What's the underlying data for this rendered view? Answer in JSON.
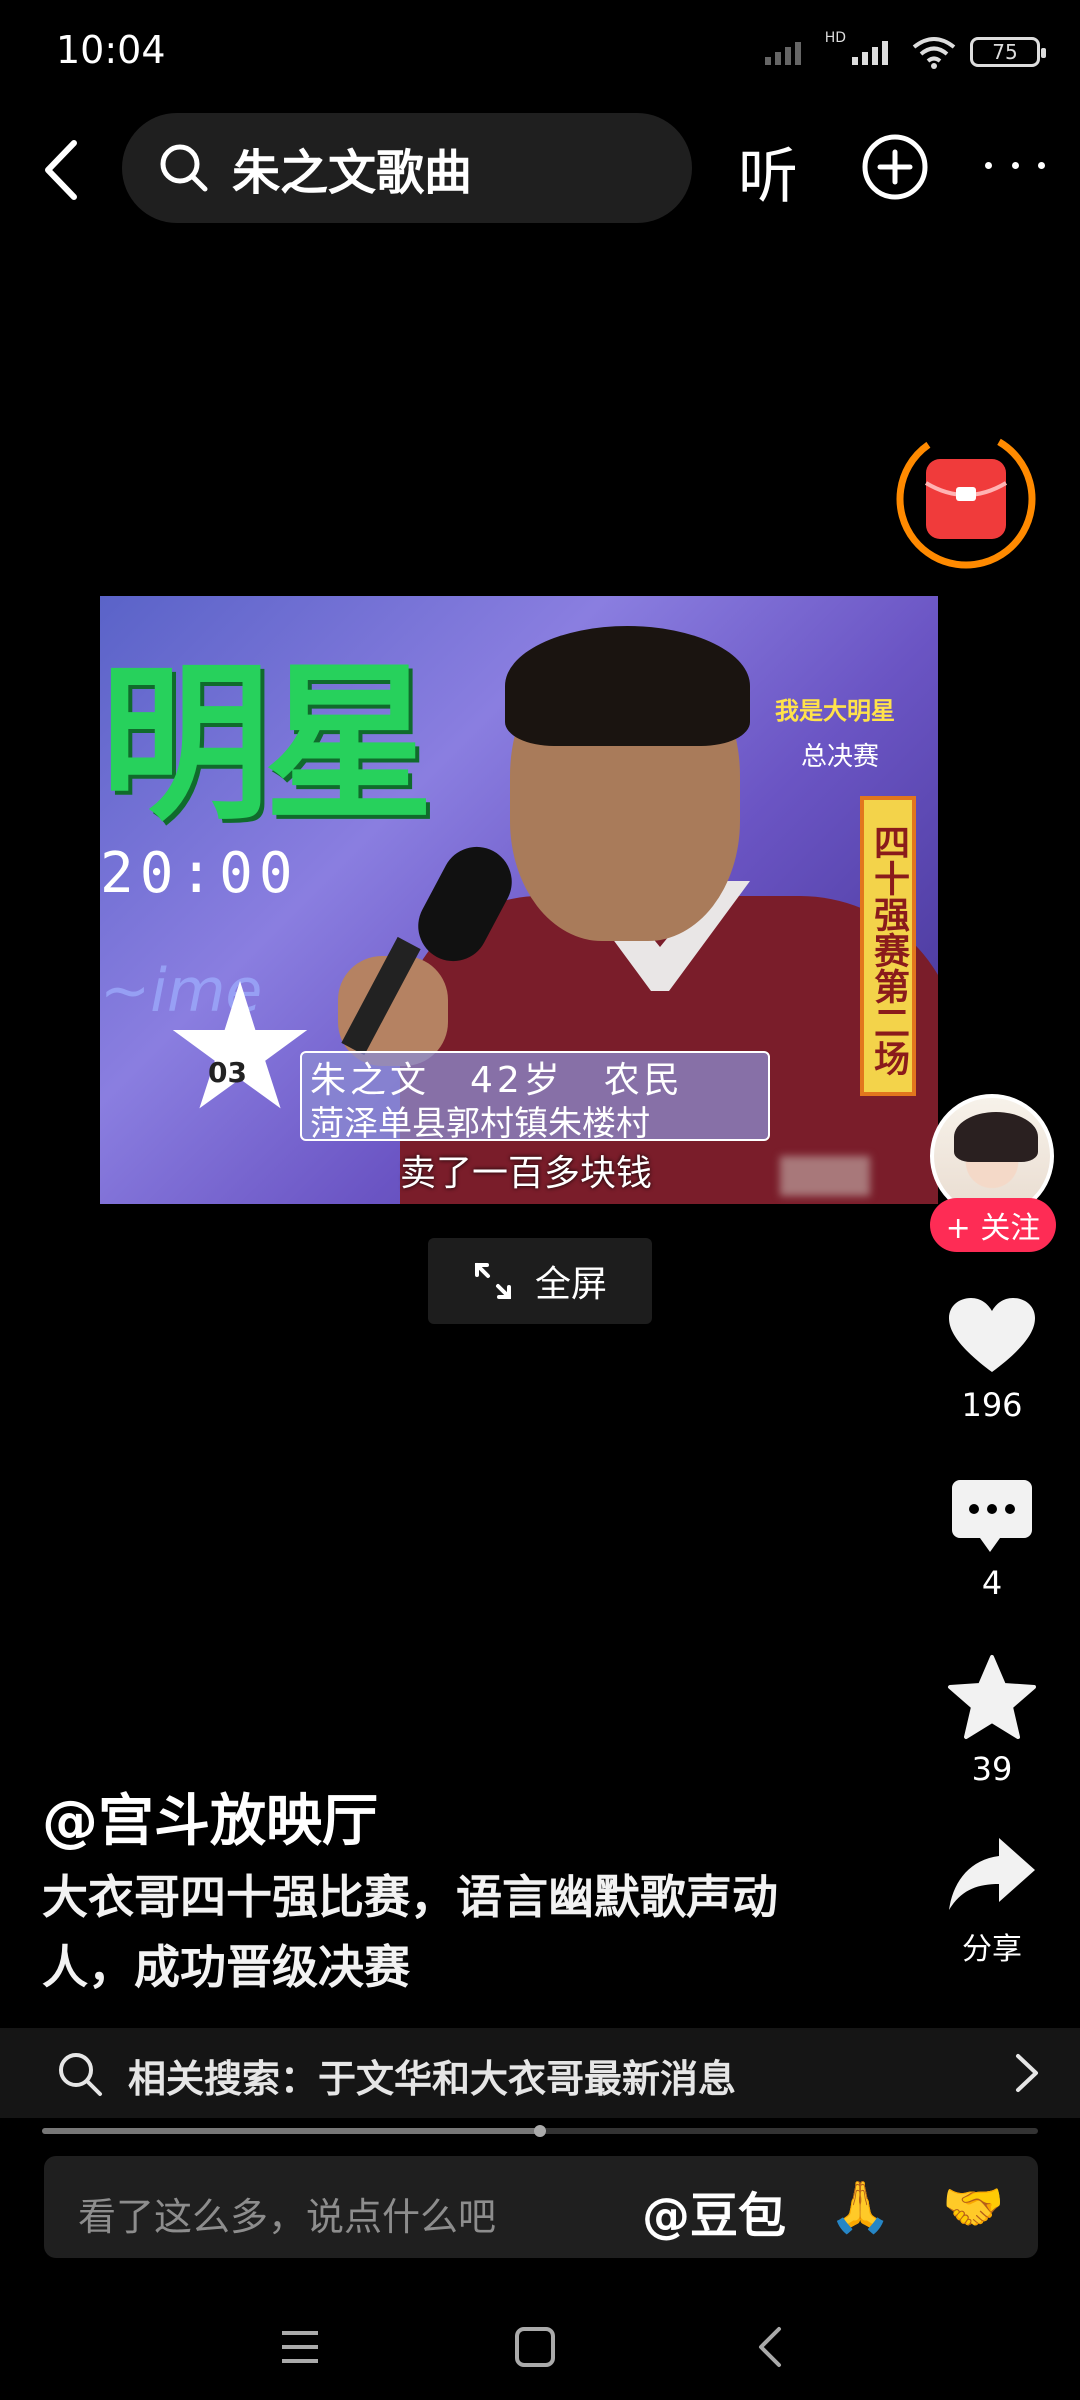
{
  "status": {
    "time": "10:04",
    "battery": "75",
    "network_badge": "HD"
  },
  "header": {
    "search_query": "朱之文歌曲",
    "listen_label": "听"
  },
  "video": {
    "overlay_text_big": "明星",
    "overlay_time": "20:00",
    "logo_line1": "我是大明星",
    "logo_line2": "总决赛",
    "side_banner": "四十强赛第二场",
    "contestant_number": "03",
    "caption_line1": "朱之文　42岁　农民",
    "caption_line2": "菏泽单县郭村镇朱楼村",
    "subtitle": "卖了一百多块钱"
  },
  "fullscreen_label": "全屏",
  "actions": {
    "follow_label": "+ 关注",
    "likes": "196",
    "comments": "4",
    "favorites": "39",
    "share_label": "分享"
  },
  "post": {
    "author": "@宫斗放映厅",
    "description": "大衣哥四十强比赛，语言幽默歌声动人，成功晋级决赛"
  },
  "related_search": {
    "text": "相关搜索：于文华和大衣哥最新消息"
  },
  "playback_progress": 0.5,
  "comment": {
    "placeholder": "看了这么多，说点什么吧",
    "mention": "@豆包",
    "emoji_1": "🙏",
    "emoji_2": "🤝"
  },
  "colors": {
    "accent": "#fe2c55",
    "redpacket_ring": "#ff8a00",
    "redpacket": "#f03b3b"
  },
  "icons": [
    "back-arrow-icon",
    "search-icon",
    "plus-circle-icon",
    "more-icon",
    "red-envelope-icon",
    "heart-icon",
    "comment-icon",
    "star-icon",
    "share-icon",
    "expand-icon",
    "chevron-right-icon",
    "menu-icon",
    "home-square-icon",
    "nav-back-icon"
  ]
}
